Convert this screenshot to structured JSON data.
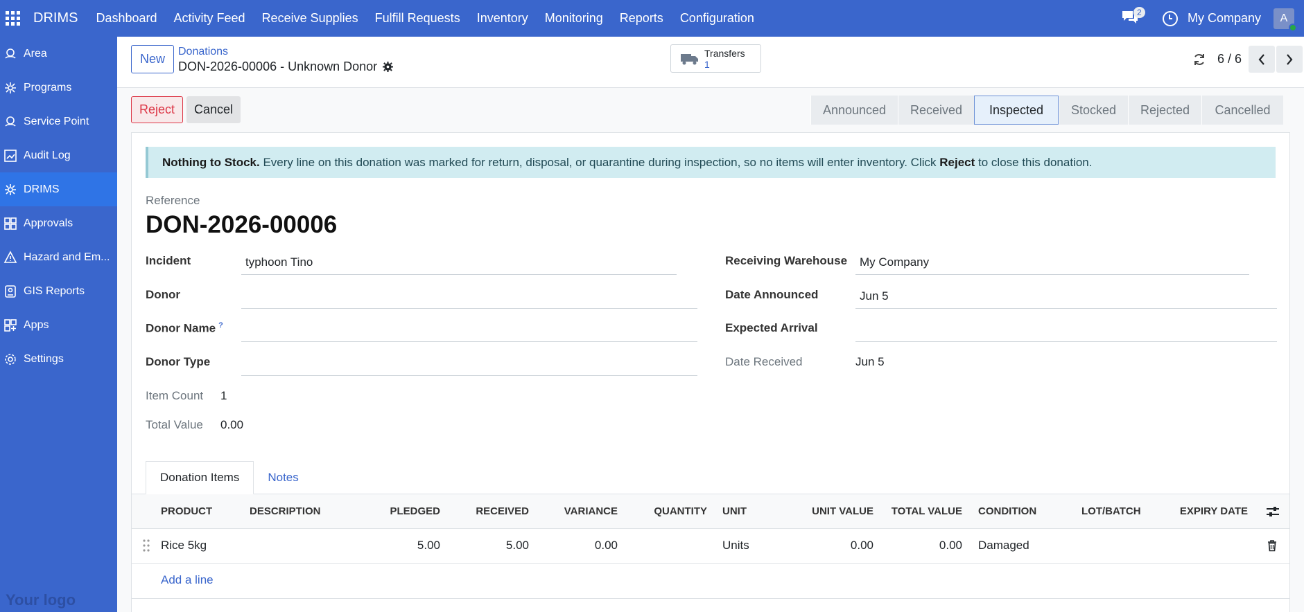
{
  "topbar": {
    "brand": "DRIMS",
    "menu": [
      "Dashboard",
      "Activity Feed",
      "Receive Supplies",
      "Fulfill Requests",
      "Inventory",
      "Monitoring",
      "Reports",
      "Configuration"
    ],
    "chat_badge": "2",
    "company": "My Company",
    "avatar": "A",
    "color": "#3a66cc"
  },
  "sidebar": {
    "items": [
      {
        "label": "Area",
        "icon": "pin-icon"
      },
      {
        "label": "Programs",
        "icon": "cog-cluster-icon"
      },
      {
        "label": "Service Point",
        "icon": "pin-icon"
      },
      {
        "label": "Audit Log",
        "icon": "chart-icon"
      },
      {
        "label": "DRIMS",
        "icon": "cog-cluster-icon",
        "active": true
      },
      {
        "label": "Approvals",
        "icon": "grid-icon"
      },
      {
        "label": "Hazard and Em...",
        "icon": "warning-icon"
      },
      {
        "label": "GIS Reports",
        "icon": "map-icon"
      },
      {
        "label": "Apps",
        "icon": "apps-plus-icon"
      },
      {
        "label": "Settings",
        "icon": "gear-icon"
      }
    ],
    "logo": "Your logo"
  },
  "control_panel": {
    "new_label": "New",
    "breadcrumb_parent": "Donations",
    "breadcrumb_current": "DON-2026-00006 - Unknown Donor",
    "transfers_label": "Transfers",
    "transfers_count": "1",
    "pager": "6 / 6"
  },
  "actions": {
    "reject": "Reject",
    "cancel": "Cancel"
  },
  "stages": [
    "Announced",
    "Received",
    "Inspected",
    "Stocked",
    "Rejected",
    "Cancelled"
  ],
  "current_stage": "Inspected",
  "alert": {
    "title": "Nothing to Stock.",
    "text_before": "Every line on this donation was marked for return, disposal, or quarantine during inspection, so no items will enter inventory. Click",
    "bold_action": "Reject",
    "text_after": "to close this donation."
  },
  "form": {
    "reference_label": "Reference",
    "reference": "DON-2026-00006",
    "incident_label": "Incident",
    "incident": "typhoon Tino",
    "donor_label": "Donor",
    "donor": "",
    "donor_name_label": "Donor Name",
    "donor_name_help": "?",
    "donor_name": "",
    "donor_type_label": "Donor Type",
    "donor_type": "",
    "item_count_label": "Item Count",
    "item_count": "1",
    "total_value_label": "Total Value",
    "total_value": "0.00",
    "warehouse_label": "Receiving Warehouse",
    "warehouse": "My Company",
    "date_announced_label": "Date Announced",
    "date_announced": "Jun 5",
    "expected_arrival_label": "Expected Arrival",
    "expected_arrival": "",
    "date_received_label": "Date Received",
    "date_received": "Jun 5"
  },
  "tabs": [
    "Donation Items",
    "Notes"
  ],
  "table": {
    "headers": [
      "PRODUCT",
      "DESCRIPTION",
      "PLEDGED",
      "RECEIVED",
      "VARIANCE",
      "QUANTITY",
      "UNIT",
      "UNIT VALUE",
      "TOTAL VALUE",
      "CONDITION",
      "LOT/BATCH",
      "EXPIRY DATE"
    ],
    "rows": [
      {
        "product": "Rice 5kg",
        "description": "",
        "pledged": "5.00",
        "received": "5.00",
        "variance": "0.00",
        "quantity": "",
        "unit": "Units",
        "unit_value": "0.00",
        "total_value": "0.00",
        "condition": "Damaged",
        "lot": "",
        "expiry": ""
      }
    ],
    "add_line": "Add a line"
  }
}
